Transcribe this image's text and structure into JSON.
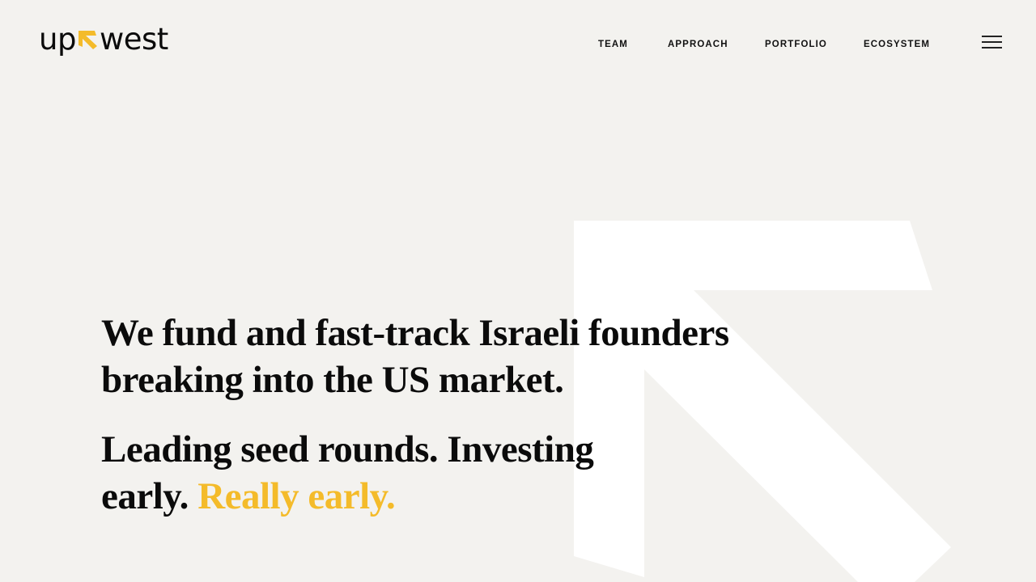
{
  "brand": {
    "name_left": "up",
    "name_right": "west",
    "accent_color": "#f4bb2a",
    "logo_icon": "arrow-up-left-icon"
  },
  "nav": {
    "items": [
      {
        "label": "TEAM"
      },
      {
        "label": "APPROACH"
      },
      {
        "label": "PORTFOLIO"
      },
      {
        "label": "ECOSYSTEM"
      }
    ],
    "menu_icon": "hamburger-menu-icon"
  },
  "hero": {
    "headline": "We fund and fast-track Israeli founders breaking into the US market.",
    "subheadline_start": "Leading seed rounds. Investing early.",
    "subheadline_accent": "Really early."
  },
  "colors": {
    "background": "#f3f2ef",
    "text": "#0b0b0b",
    "accent": "#f4bb2a",
    "decorative_arrow": "#ffffff"
  }
}
